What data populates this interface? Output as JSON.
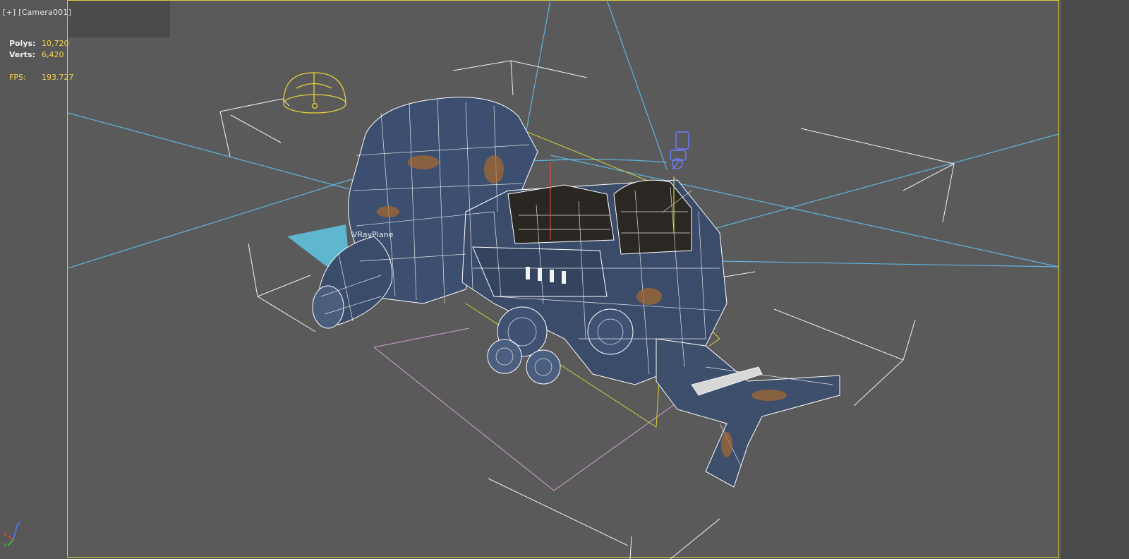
{
  "viewport": {
    "menu_label": "[+]",
    "camera_label": "[Camera001]"
  },
  "stats": {
    "polys_label": "Polys:",
    "polys_value": "10,720",
    "verts_label": "Verts:",
    "verts_value": "6,420",
    "fps_label": "FPS:",
    "fps_value": "193.727"
  },
  "scene": {
    "vray_plane_label": "VRayPlane"
  },
  "axis": {
    "z": "z",
    "x": "x",
    "y": "y"
  },
  "colors": {
    "frame_border": "#d7d03a",
    "stats_value": "#f3d54a",
    "camera_line": "#5fb4e0",
    "wire": "#ffffff",
    "vehicle_metal": "#3c4f70"
  }
}
